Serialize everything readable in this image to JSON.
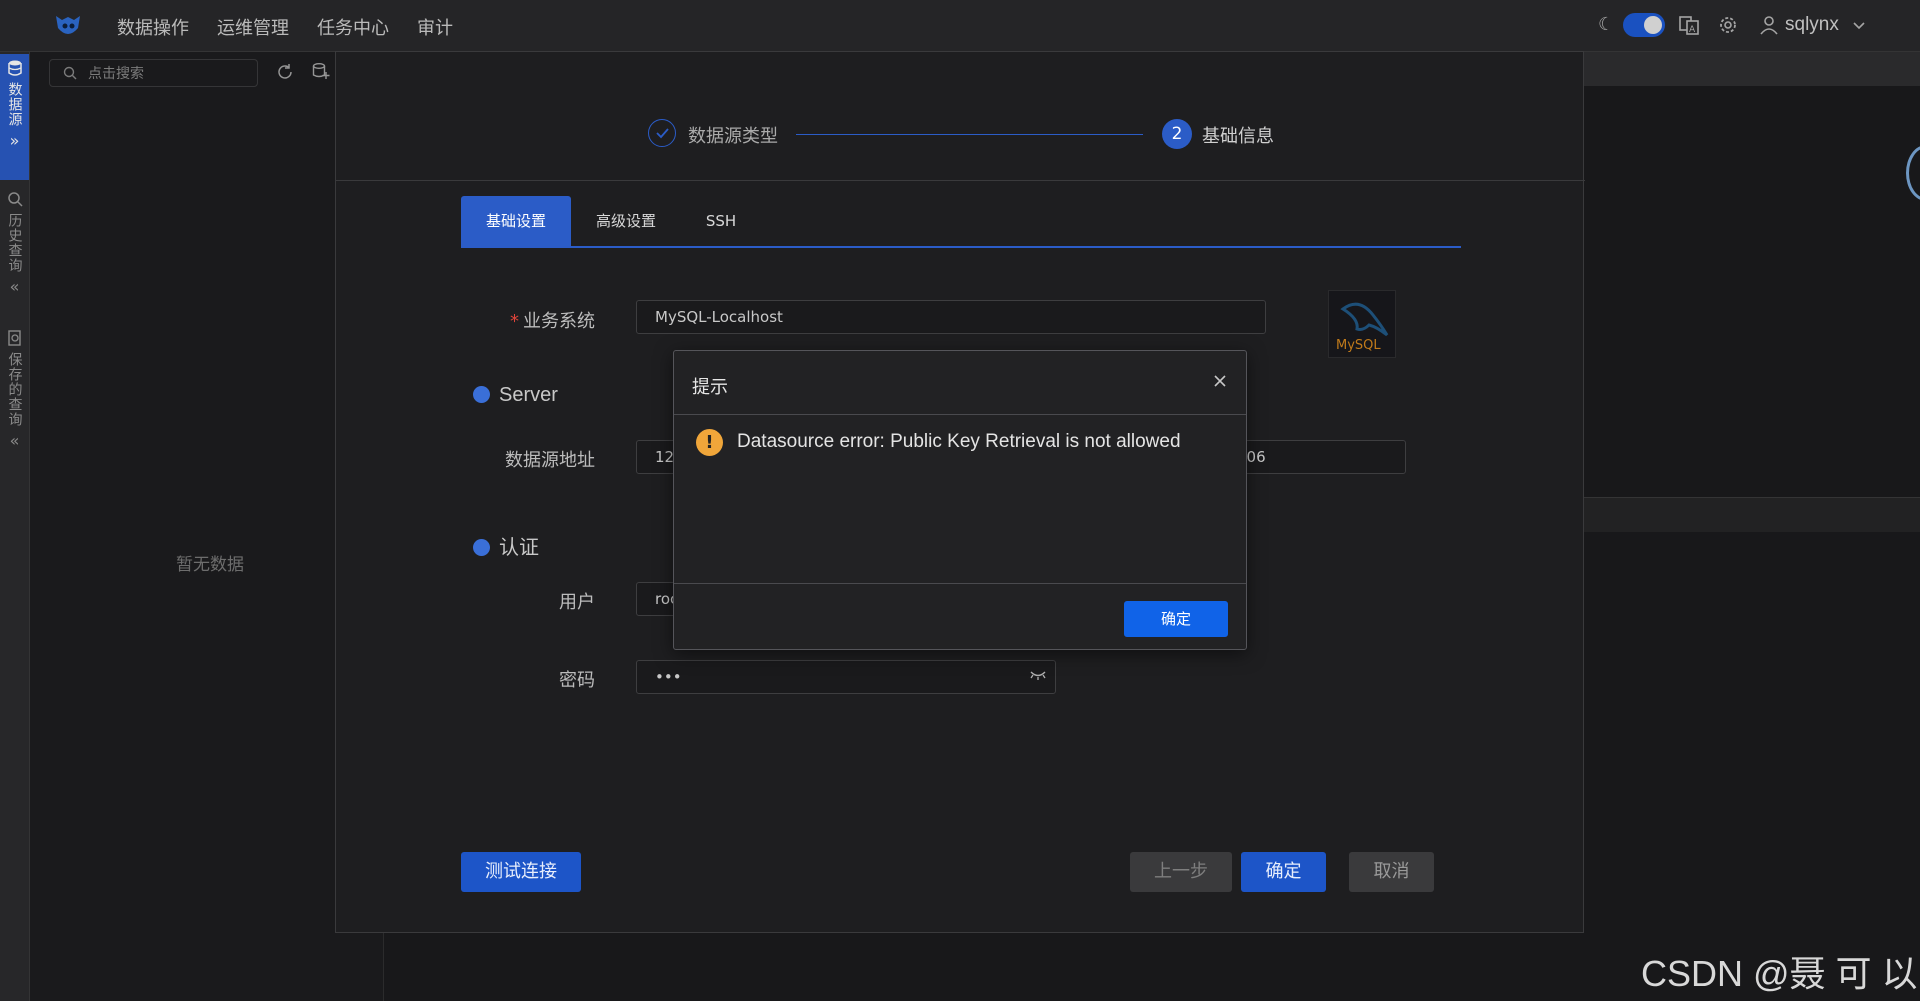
{
  "topbar": {
    "nav": [
      "数据操作",
      "运维管理",
      "任务中心",
      "审计"
    ],
    "username": "sqlynx"
  },
  "rail": {
    "datasource": "数据源",
    "history": "历史查询",
    "saved": "保存的查询"
  },
  "leftpanel": {
    "search_placeholder": "点击搜索",
    "empty": "暂无数据"
  },
  "wizard": {
    "step1": "数据源类型",
    "step2_num": "2",
    "step2": "基础信息",
    "tabs": [
      "基础设置",
      "高级设置",
      "SSH"
    ],
    "fields": {
      "system_label": "业务系统",
      "system_value": "MySQL-Localhost",
      "server_section": "Server",
      "address_label": "数据源地址",
      "address_value": "12",
      "port_value": "306",
      "auth_section": "认证",
      "user_label": "用户",
      "user_value": "roc",
      "password_label": "密码",
      "password_value": "•••"
    },
    "buttons": {
      "test": "测试连接",
      "prev": "上一步",
      "ok": "确定",
      "cancel": "取消"
    },
    "logo_text": "MySQL"
  },
  "alert": {
    "title": "提示",
    "message": "Datasource error: Public Key Retrieval is not allowed",
    "ok": "确定"
  },
  "watermark": "CSDN @聂 可 以",
  "colors": {
    "accent": "#2b5cc7",
    "primary_button": "#1063e8",
    "warning": "#f0a63a",
    "required": "#e0443a"
  }
}
